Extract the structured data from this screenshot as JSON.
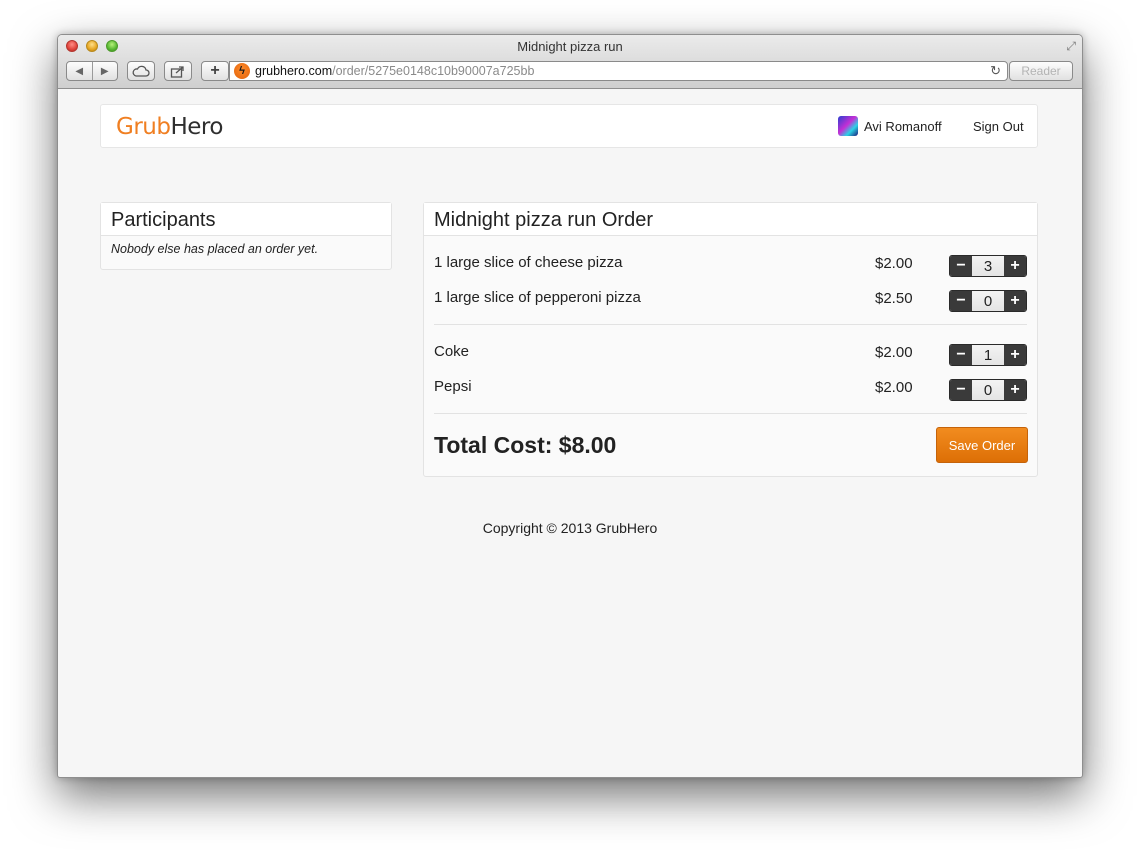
{
  "window": {
    "title": "Midnight pizza run",
    "url_host": "grubhero.com",
    "url_path": "/order/5275e0148c10b90007a725bb",
    "reader_label": "Reader"
  },
  "navbar": {
    "brand_part1": "Grub",
    "brand_part2": "Hero",
    "user_name": "Avi Romanoff",
    "sign_out": "Sign Out"
  },
  "participants": {
    "title": "Participants",
    "empty_message": "Nobody else has placed an order yet."
  },
  "order": {
    "title": "Midnight pizza run Order",
    "groups": [
      [
        {
          "name": "1 large slice of cheese pizza",
          "price": "$2.00",
          "qty": "3"
        },
        {
          "name": "1 large slice of pepperoni pizza",
          "price": "$2.50",
          "qty": "0"
        }
      ],
      [
        {
          "name": "Coke",
          "price": "$2.00",
          "qty": "1"
        },
        {
          "name": "Pepsi",
          "price": "$2.00",
          "qty": "0"
        }
      ]
    ],
    "stepper_minus": "−",
    "stepper_plus": "+",
    "total_label": "Total Cost: $8.00",
    "save_label": "Save Order"
  },
  "footer": {
    "copyright": "Copyright © 2013 GrubHero"
  },
  "colors": {
    "brand_orange": "#f07f22",
    "save_button": "#e07808",
    "stepper_dark": "#3a3a3a"
  }
}
